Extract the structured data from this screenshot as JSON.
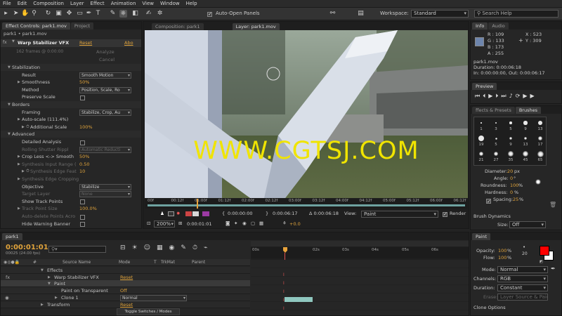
{
  "menu": [
    "File",
    "Edit",
    "Composition",
    "Layer",
    "Effect",
    "Animation",
    "View",
    "Window",
    "Help"
  ],
  "toolbar": {
    "auto_open": "Auto-Open Panels",
    "workspace_label": "Workspace:",
    "workspace_value": "Standard",
    "search_placeholder": "Search Help"
  },
  "effect_controls": {
    "tab": "Effect Controls: park1.mov",
    "tab2": "Project",
    "breadcrumb": "park1 • park1.mov",
    "effect_name": "Warp Stabilizer VFX",
    "reset": "Reset",
    "about": "Abo",
    "frames_info": "162 frames @ 0:00:00",
    "analyze": "Analyze",
    "cancel": "Cancel",
    "rows": [
      {
        "t": "Stabilization",
        "lvl": 1,
        "open": true
      },
      {
        "t": "Result",
        "lvl": 2,
        "sel": "Smooth Motion"
      },
      {
        "t": "Smoothness",
        "lvl": 2,
        "tri": true,
        "val": "50%"
      },
      {
        "t": "Method",
        "lvl": 2,
        "sel": "Position, Scale, Ro"
      },
      {
        "t": "Preserve Scale",
        "lvl": 2,
        "chk": false
      },
      {
        "t": "Borders",
        "lvl": 1,
        "open": true
      },
      {
        "t": "Framing",
        "lvl": 2,
        "sel": "Stabilize, Crop, Au"
      },
      {
        "t": "Auto-scale (111.4%)",
        "lvl": 2,
        "tri": true
      },
      {
        "t": "Additional Scale",
        "lvl": 3,
        "tri": true,
        "val": "100%"
      },
      {
        "t": "Advanced",
        "lvl": 1,
        "open": true
      },
      {
        "t": "Detailed Analysis",
        "lvl": 2,
        "chk": false
      },
      {
        "t": "Rolling Shutter Rippl",
        "lvl": 2,
        "dim": true,
        "sel": "Automatic Reducti"
      },
      {
        "t": "Crop Less <-> Smooth",
        "lvl": 2,
        "tri": true,
        "val": "50%"
      },
      {
        "t": "Synthesis Input Range (",
        "lvl": 2,
        "tri": true,
        "dim": true,
        "val": "0.50"
      },
      {
        "t": "Synthesis Edge Feat",
        "lvl": 3,
        "tri": true,
        "dim": true,
        "val": "10"
      },
      {
        "t": "Synthesis Edge Cropping",
        "lvl": 2,
        "tri": true,
        "dim": true
      },
      {
        "t": "Objective",
        "lvl": 2,
        "sel": "Stabilize"
      },
      {
        "t": "Target Layer",
        "lvl": 2,
        "dim": true,
        "sel": "None"
      },
      {
        "t": "Show Track Points",
        "lvl": 2,
        "chk": false
      },
      {
        "t": "Track Point Size",
        "lvl": 2,
        "tri": true,
        "dim": true,
        "val": "100.0%"
      },
      {
        "t": "Auto-delete Points Acro",
        "lvl": 2,
        "dim": true,
        "chk": false
      },
      {
        "t": "Hide Warning Banner",
        "lvl": 2,
        "chk": false
      }
    ]
  },
  "viewer": {
    "tab1": "Composition: park1",
    "tab2": "Layer: park1.mov",
    "watermark": "WWW.CGTSJ.COM",
    "ruler_labels": [
      "00f",
      "00:12f",
      "01:00f",
      "01:12f",
      "02:00f",
      "02:12f",
      "03:00f",
      "03:12f",
      "04:00f",
      "04:12f",
      "05:00f",
      "05:12f",
      "06:00f",
      "06:12f"
    ],
    "time_start": "0:00:00:00",
    "time_end": "0:00:06:17",
    "duration": "Δ 0:00:06:18",
    "view_label": "View:",
    "view_value": "Paint",
    "render": "Render",
    "zoom": "200%",
    "current_time": "0:00:01:01",
    "offset": "+0.0"
  },
  "info": {
    "tab1": "Info",
    "tab2": "Audio",
    "r": "R : 109",
    "g": "G : 133",
    "b": "B : 173",
    "a": "A : 255",
    "x": "X : 523",
    "y": "Y : 309",
    "file": "park1.mov",
    "duration": "Duration: 0:00:06:18",
    "inout": "In: 0:00:00:00, Out: 0:00:06:17",
    "swatch": "#6d85ad"
  },
  "preview": {
    "title": "Preview"
  },
  "brushes": {
    "tab1": "ffects & Presets",
    "tab2": "Brushes",
    "sizes": [
      "1",
      "3",
      "5",
      "9",
      "13",
      "19",
      "5",
      "9",
      "13",
      "17",
      "21",
      "27",
      "35",
      "45",
      "65"
    ],
    "diameter_label": "Diameter:",
    "diameter_val": "20",
    "diameter_unit": "px",
    "angle_label": "Angle:",
    "angle_val": "0",
    "angle_unit": "°",
    "roundness_label": "Roundness:",
    "roundness_val": "100",
    "roundness_unit": "%",
    "hardness_label": "Hardness:",
    "hardness_val": "0",
    "hardness_unit": "%",
    "spacing_label": "Spacing:",
    "spacing_val": "25",
    "spacing_unit": "%",
    "dynamics": "Brush Dynamics",
    "size_label": "Size:",
    "size_val": "Off"
  },
  "timeline": {
    "tab": "park1",
    "time": "0:00:01:01",
    "fps": "00025 (24.00 fps)",
    "search_placeholder": "",
    "headers": {
      "source": "Source Name",
      "mode": "Mode",
      "t": "T",
      "trkmat": "TrkMat",
      "parent": "Parent"
    },
    "ticks": [
      "00s",
      "02s",
      "03s",
      "04s",
      "05s",
      "06s"
    ],
    "rows": [
      {
        "name": "Effects",
        "indent": 1,
        "tri": "open"
      },
      {
        "name": "Warp Stabilizer VFX",
        "indent": 2,
        "tri": "closed",
        "val": "Reset"
      },
      {
        "name": "Paint",
        "indent": 2,
        "tri": "open",
        "sel": true
      },
      {
        "name": "Paint on Transparent",
        "indent": 3,
        "val": "Off"
      },
      {
        "name": "Clone 1",
        "indent": 3,
        "tri": "closed",
        "mode": "Normal"
      },
      {
        "name": "Transform",
        "indent": 1,
        "tri": "closed",
        "val": "Reset"
      }
    ],
    "toggle": "Toggle Switches / Modes"
  },
  "paint": {
    "title": "Paint",
    "opacity_label": "Opacity:",
    "opacity_val": "100",
    "opacity_unit": "%",
    "flow_label": "Flow:",
    "flow_val": "100",
    "flow_unit": "%",
    "size_num": "20",
    "mode_label": "Mode:",
    "mode_val": "Normal",
    "channels_label": "Channels:",
    "channels_val": "RGB",
    "duration_label": "Duration:",
    "duration_val": "Constant",
    "erase_label": "Erase:",
    "erase_val": "Layer Source & Paint",
    "clone_options": "Clone Options",
    "fg_color": "#ff0000",
    "bg_color": "#ffffff"
  }
}
